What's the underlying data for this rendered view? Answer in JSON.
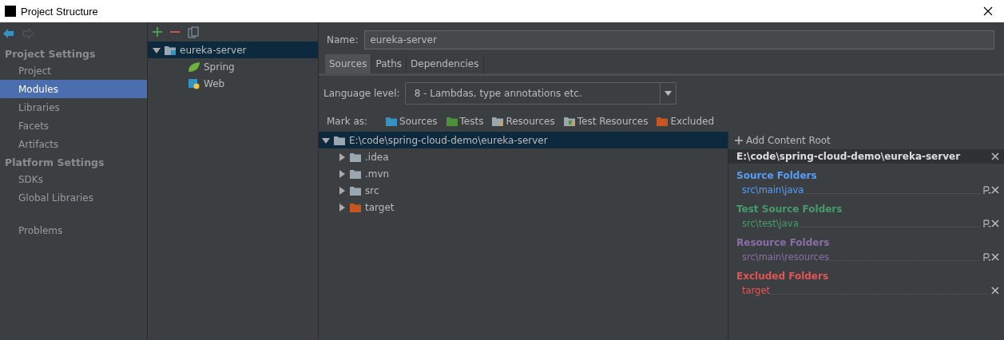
{
  "window": {
    "title": "Project Structure"
  },
  "sidebar": {
    "sections": [
      {
        "title": "Project Settings",
        "items": [
          {
            "label": "Project",
            "selected": false
          },
          {
            "label": "Modules",
            "selected": true
          },
          {
            "label": "Libraries",
            "selected": false
          },
          {
            "label": "Facets",
            "selected": false
          },
          {
            "label": "Artifacts",
            "selected": false
          }
        ]
      },
      {
        "title": "Platform Settings",
        "items": [
          {
            "label": "SDKs",
            "selected": false
          },
          {
            "label": "Global Libraries",
            "selected": false
          }
        ]
      },
      {
        "items": [
          {
            "label": "Problems",
            "selected": false
          }
        ]
      }
    ]
  },
  "module_tree": {
    "items": [
      {
        "label": "eureka-server",
        "kind": "module",
        "selected": true,
        "expanded": true,
        "children": [
          {
            "label": "Spring",
            "kind": "spring",
            "selected": false
          },
          {
            "label": "Web",
            "kind": "web",
            "selected": false
          }
        ]
      }
    ]
  },
  "name_field": {
    "label": "Name:",
    "value": "eureka-server"
  },
  "tabs": [
    {
      "label": "Sources",
      "selected": true
    },
    {
      "label": "Paths",
      "selected": false
    },
    {
      "label": "Dependencies",
      "selected": false
    }
  ],
  "language_level": {
    "label": "Language level:",
    "value": "8 - Lambdas, type annotations etc."
  },
  "mark_as": {
    "label": "Mark as:",
    "items": [
      {
        "label": "Sources",
        "color": "#3592c4",
        "kind": "plain"
      },
      {
        "label": "Tests",
        "color": "#4e8f3a",
        "kind": "plain"
      },
      {
        "label": "Resources",
        "color": "#9aa7b0",
        "kind": "lined"
      },
      {
        "label": "Test Resources",
        "color": "#9aa7b0",
        "kind": "lined-green"
      },
      {
        "label": "Excluded",
        "color": "#c75520",
        "kind": "plain"
      }
    ]
  },
  "folder_tree": {
    "root": {
      "label": "E:\\code\\spring-cloud-demo\\eureka-server",
      "selected": true,
      "expanded": true,
      "children": [
        {
          "label": ".idea",
          "color": "#9aa7b0",
          "expanded": false
        },
        {
          "label": ".mvn",
          "color": "#9aa7b0",
          "expanded": false
        },
        {
          "label": "src",
          "color": "#9aa7b0",
          "expanded": false
        },
        {
          "label": "target",
          "color": "#c75520",
          "expanded": false
        }
      ]
    }
  },
  "content_root": {
    "add_label": "Add Content Root",
    "path": "E:\\code\\spring-cloud-demo\\eureka-server",
    "groups": [
      {
        "title": "Source Folders",
        "color": "#589df6",
        "folders": [
          "src\\main\\java"
        ]
      },
      {
        "title": "Test Source Folders",
        "color": "#479a6c",
        "folders": [
          "src\\test\\java"
        ]
      },
      {
        "title": "Resource Folders",
        "color": "#8a6ea8",
        "folders": [
          "src\\main\\resources"
        ]
      },
      {
        "title": "Excluded Folders",
        "color": "#e05555",
        "folders": [
          "target"
        ]
      }
    ]
  }
}
